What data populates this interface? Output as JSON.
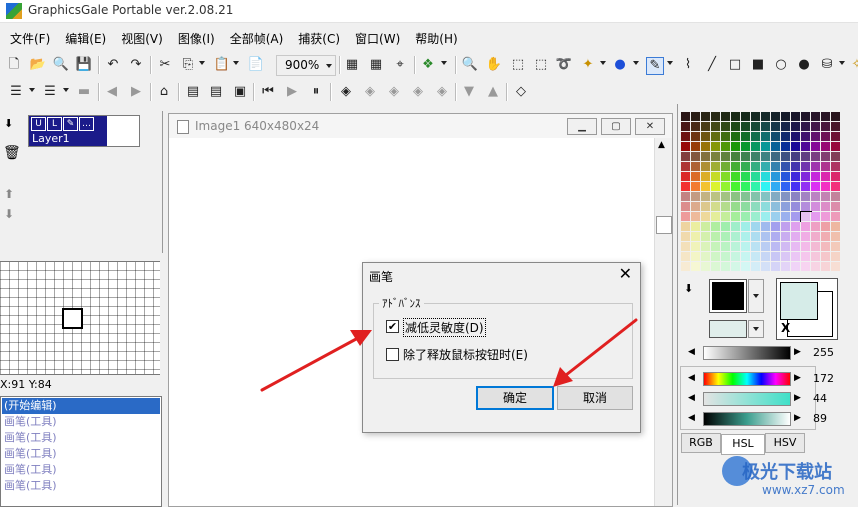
{
  "app": {
    "title": "GraphicsGale Portable ver.2.08.21"
  },
  "menu": [
    "文件(F)",
    "编辑(E)",
    "视图(V)",
    "图像(I)",
    "全部帧(A)",
    "捕获(C)",
    "窗口(W)",
    "帮助(H)"
  ],
  "toolbar": {
    "zoom": "900%"
  },
  "layers": {
    "name": "Layer1"
  },
  "status": {
    "coords": "X:91 Y:84"
  },
  "history": [
    "(开始编辑)",
    "画笔(工具)",
    "画笔(工具)",
    "画笔(工具)",
    "画笔(工具)",
    "画笔(工具)"
  ],
  "document": {
    "title": "Image1 640x480x24"
  },
  "dialog": {
    "title": "画笔",
    "group_label": "ｱﾄﾞﾊﾞﾝｽ",
    "option1": {
      "label": "减低灵敏度(D)",
      "checked": true
    },
    "option2": {
      "label": "除了释放鼠标按钮时(E)",
      "checked": false
    },
    "ok_label": "确定",
    "cancel_label": "取消"
  },
  "color_panel": {
    "value_row1": "255",
    "hsl_h": "172",
    "hsl_s": "44",
    "hsl_l": "89",
    "tabs": [
      "RGB",
      "HSL",
      "HSV"
    ],
    "active_tab": "HSL",
    "fg_color": "#000000",
    "bg_color": "#d6ece8"
  },
  "annotation_color": "#e02020",
  "watermark": {
    "name": "极光下载站",
    "url": "www.xz7.com"
  }
}
